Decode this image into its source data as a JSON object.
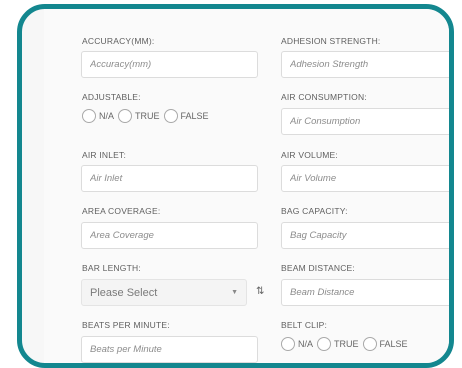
{
  "form": {
    "accuracy": {
      "label": "ACCURACY(MM):",
      "placeholder": "Accuracy(mm)"
    },
    "adhesion_strength": {
      "label": "ADHESION STRENGTH:",
      "placeholder": "Adhesion Strength"
    },
    "adjustable": {
      "label": "ADJUSTABLE:",
      "options": [
        "N/A",
        "TRUE",
        "FALSE"
      ]
    },
    "air_consumption": {
      "label": "AIR CONSUMPTION:",
      "placeholder": "Air Consumption"
    },
    "air_inlet": {
      "label": "AIR INLET:",
      "placeholder": "Air Inlet"
    },
    "air_volume": {
      "label": "AIR VOLUME:",
      "placeholder": "Air Volume"
    },
    "area_coverage": {
      "label": "AREA COVERAGE:",
      "placeholder": "Area Coverage"
    },
    "bag_capacity": {
      "label": "BAG CAPACITY:",
      "placeholder": "Bag Capacity"
    },
    "bar_length": {
      "label": "BAR LENGTH:",
      "selected": "Please Select",
      "caret_icon": "chevron-down-icon",
      "reload_icon": "refresh-icon",
      "reload_glyph": "⇅"
    },
    "beam_distance": {
      "label": "BEAM DISTANCE:",
      "placeholder": "Beam Distance"
    },
    "beats_per_minute": {
      "label": "BEATS PER MINUTE:",
      "placeholder": "Beats per Minute"
    },
    "belt_clip": {
      "label": "BELT CLIP:",
      "options": [
        "N/A",
        "TRUE",
        "FALSE"
      ]
    }
  },
  "colors": {
    "frame_border": "#13878f",
    "panel_bg": "#fafafa",
    "input_border": "#dcdcdc"
  }
}
